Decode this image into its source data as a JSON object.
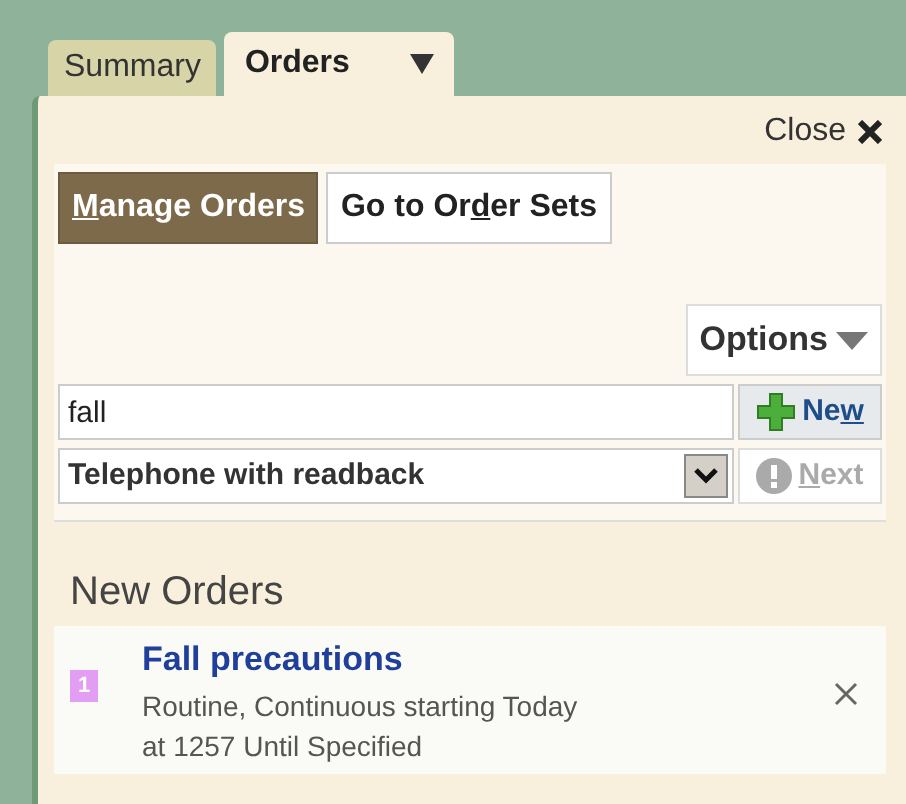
{
  "tabs": [
    {
      "label": "Summary",
      "selected": false,
      "has_menu": false
    },
    {
      "label": "Orders",
      "selected": true,
      "has_menu": true
    }
  ],
  "close": {
    "label": "Close"
  },
  "mode_buttons": [
    {
      "label": {
        "key": "M",
        "after": "anage Orders"
      },
      "selected": true
    },
    {
      "label": {
        "before": "Go to Or",
        "key": "d",
        "after": "er Sets"
      },
      "selected": false
    }
  ],
  "options": {
    "label": "Options"
  },
  "search": {
    "value": "fall"
  },
  "new_button": {
    "label": {
      "before": "Ne",
      "key": "w"
    },
    "disabled": false
  },
  "order_mode": {
    "value": "Telephone with readback"
  },
  "next_button": {
    "label": {
      "key": "N",
      "after": "ext"
    },
    "disabled": true
  },
  "new_orders": {
    "heading": "New Orders",
    "items": [
      {
        "badge": "1",
        "color": "#e29ef3",
        "title": "Fall precautions",
        "details": [
          "Routine, Continuous starting Today",
          "at 1257 Until Specified"
        ]
      }
    ]
  }
}
